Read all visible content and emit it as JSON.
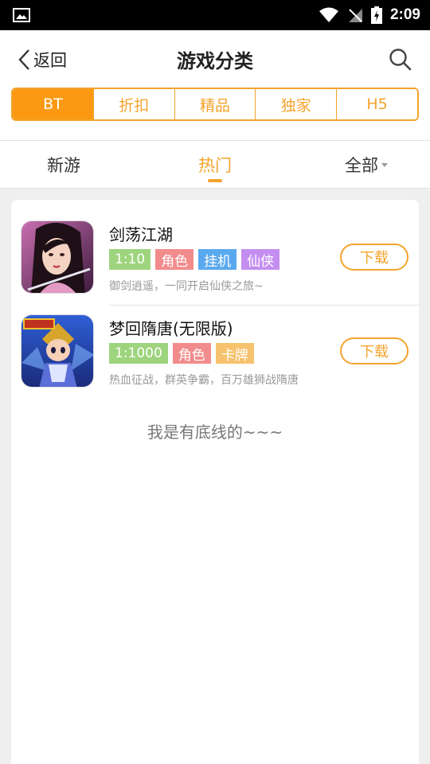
{
  "status_bar": {
    "time": "2:09",
    "icons": [
      "image-icon",
      "wifi-icon",
      "no-signal-icon",
      "battery-charging-icon"
    ]
  },
  "header": {
    "back_label": "返回",
    "title": "游戏分类",
    "icons": [
      "chevron-left-icon",
      "search-icon"
    ]
  },
  "segments": [
    {
      "label": "BT",
      "active": true
    },
    {
      "label": "折扣",
      "active": false
    },
    {
      "label": "精品",
      "active": false
    },
    {
      "label": "独家",
      "active": false
    },
    {
      "label": "H5",
      "active": false
    }
  ],
  "tabs": [
    {
      "label": "新游",
      "active": false
    },
    {
      "label": "热门",
      "active": true
    },
    {
      "label": "全部",
      "active": false,
      "dropdown": true
    }
  ],
  "games": [
    {
      "name": "剑荡江湖",
      "tags": [
        {
          "text": "1:10",
          "color": "#9dd47d"
        },
        {
          "text": "角色",
          "color": "#f28c8c"
        },
        {
          "text": "挂机",
          "color": "#5aa9ef"
        },
        {
          "text": "仙侠",
          "color": "#c48ef0"
        }
      ],
      "description": "御剑逍遥，一同开启仙侠之旅~",
      "download_label": "下载",
      "icon": "game-portrait-icon"
    },
    {
      "name": "梦回隋唐(无限版)",
      "tags": [
        {
          "text": "1:1000",
          "color": "#9dd47d"
        },
        {
          "text": "角色",
          "color": "#f28c8c"
        },
        {
          "text": "卡牌",
          "color": "#f7c26d"
        }
      ],
      "description": "热血征战，群英争霸，百万雄狮战隋唐",
      "download_label": "下载",
      "icon": "game-warrior-icon"
    }
  ],
  "footer_note": "我是有底线的~~~",
  "colors": {
    "accent": "#f4a32c",
    "accent_fill": "#fb9a12"
  }
}
